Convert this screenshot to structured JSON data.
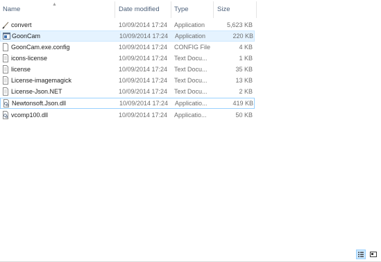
{
  "columns": {
    "name": "Name",
    "date": "Date modified",
    "type": "Type",
    "size": "Size"
  },
  "files": [
    {
      "name": "convert",
      "date": "10/09/2014 17:24",
      "type": "Application",
      "size": "5,623 KB",
      "icon": "brush-app-icon",
      "state": ""
    },
    {
      "name": "GoonCam",
      "date": "10/09/2014 17:24",
      "type": "Application",
      "size": "220 KB",
      "icon": "app-window-icon",
      "state": "hover"
    },
    {
      "name": "GoonCam.exe.config",
      "date": "10/09/2014 17:24",
      "type": "CONFIG File",
      "size": "4 KB",
      "icon": "blank-file-icon",
      "state": ""
    },
    {
      "name": "icons-license",
      "date": "10/09/2014 17:24",
      "type": "Text Docu...",
      "size": "1 KB",
      "icon": "text-file-icon",
      "state": ""
    },
    {
      "name": "license",
      "date": "10/09/2014 17:24",
      "type": "Text Docu...",
      "size": "35 KB",
      "icon": "text-file-icon",
      "state": ""
    },
    {
      "name": "License-imagemagick",
      "date": "10/09/2014 17:24",
      "type": "Text Docu...",
      "size": "13 KB",
      "icon": "text-file-icon",
      "state": ""
    },
    {
      "name": "License-Json.NET",
      "date": "10/09/2014 17:24",
      "type": "Text Docu...",
      "size": "2 KB",
      "icon": "text-file-icon",
      "state": ""
    },
    {
      "name": "Newtonsoft.Json.dll",
      "date": "10/09/2014 17:24",
      "type": "Applicatio...",
      "size": "419 KB",
      "icon": "dll-file-icon",
      "state": "selected"
    },
    {
      "name": "vcomp100.dll",
      "date": "10/09/2014 17:24",
      "type": "Applicatio...",
      "size": "50 KB",
      "icon": "dll-file-icon",
      "state": ""
    }
  ],
  "view_buttons": {
    "details": "details-view-icon",
    "large_icons": "large-icons-view-icon"
  },
  "colors": {
    "hover_bg": "#e5f3ff",
    "selected_border": "#99d1ff",
    "header_text": "#4c607a"
  }
}
